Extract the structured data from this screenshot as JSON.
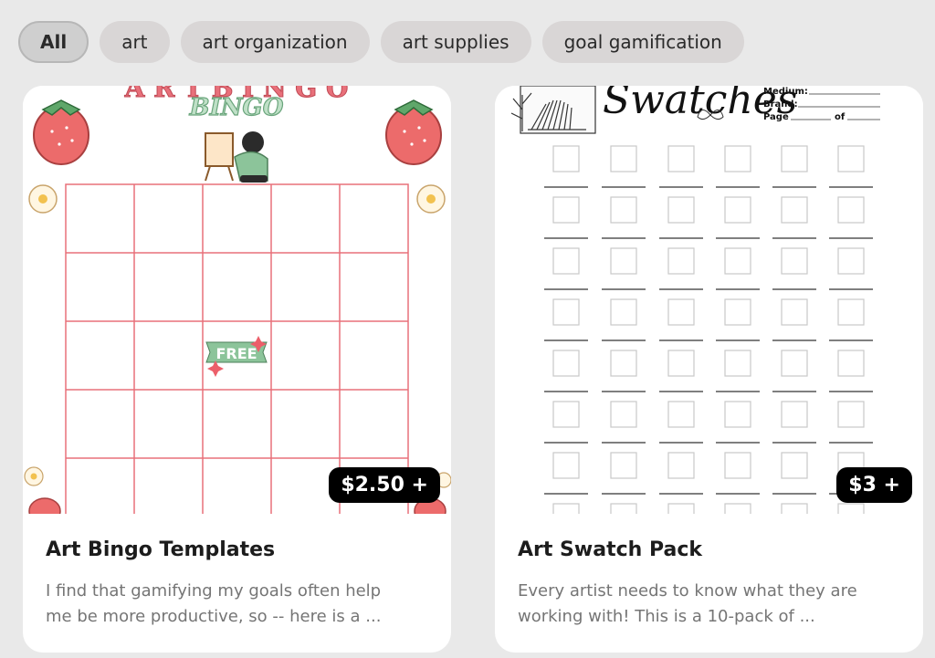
{
  "filters": [
    {
      "label": "All",
      "active": true
    },
    {
      "label": "art",
      "active": false
    },
    {
      "label": "art organization",
      "active": false
    },
    {
      "label": "art supplies",
      "active": false
    },
    {
      "label": "goal gamification",
      "active": false
    }
  ],
  "products": [
    {
      "title": "Art Bingo Templates",
      "price": "$2.50 +",
      "description_line1": "I find that gamifying my goals often help",
      "description_line2": "me be more productive, so -- here is a ...",
      "thumbnail": {
        "heading": "BINGO",
        "center_square": "FREE",
        "accent_color": "#e8707a",
        "green_color": "#8cc49a"
      }
    },
    {
      "title": "Art Swatch Pack",
      "price": "$3 +",
      "description_line1": "Every artist needs to know what they are",
      "description_line2": "working with!  This is a 10-pack of ...",
      "thumbnail": {
        "heading": "Swatches",
        "field_medium": "Medium:",
        "field_brand": "Brand:",
        "field_page": "Page",
        "field_of": "of"
      }
    }
  ]
}
